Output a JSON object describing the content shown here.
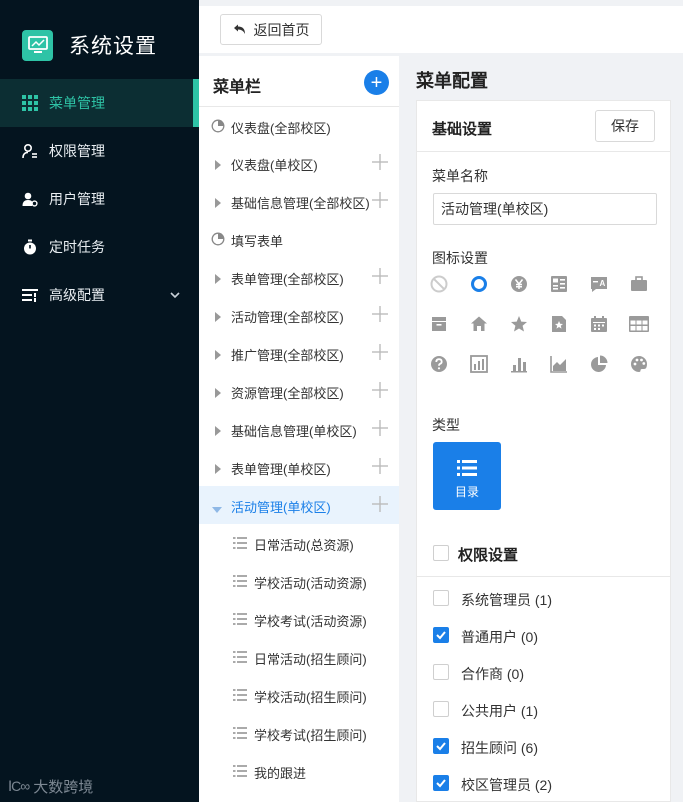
{
  "app": {
    "title": "系统设置"
  },
  "sidebar": {
    "items": [
      {
        "label": "菜单管理",
        "icon": "grid-icon"
      },
      {
        "label": "权限管理",
        "icon": "user-key-icon"
      },
      {
        "label": "用户管理",
        "icon": "user-gear-icon"
      },
      {
        "label": "定时任务",
        "icon": "stopwatch-icon"
      },
      {
        "label": "高级配置",
        "icon": "sliders-icon"
      }
    ],
    "footer": "大数跨境"
  },
  "toolbar": {
    "back_label": "返回首页"
  },
  "menu_panel": {
    "title": "菜单栏",
    "add_symbol": "+",
    "items": [
      {
        "label": "仪表盘(全部校区)"
      },
      {
        "label": "仪表盘(单校区)"
      },
      {
        "label": "基础信息管理(全部校区)"
      },
      {
        "label": "填写表单"
      },
      {
        "label": "表单管理(全部校区)"
      },
      {
        "label": "活动管理(全部校区)"
      },
      {
        "label": "推广管理(全部校区)"
      },
      {
        "label": "资源管理(全部校区)"
      },
      {
        "label": "基础信息管理(单校区)"
      },
      {
        "label": "表单管理(单校区)"
      },
      {
        "label": "活动管理(单校区)"
      },
      {
        "label": "日常活动(总资源)"
      },
      {
        "label": "学校活动(活动资源)"
      },
      {
        "label": "学校考试(活动资源)"
      },
      {
        "label": "日常活动(招生顾问)"
      },
      {
        "label": "学校活动(招生顾问)"
      },
      {
        "label": "学校考试(招生顾问)"
      },
      {
        "label": "我的跟进"
      }
    ]
  },
  "config": {
    "title": "菜单配置",
    "card_title": "基础设置",
    "save_label": "保存",
    "name_label": "菜单名称",
    "name_value": "活动管理(单校区)",
    "icon_label": "图标设置",
    "type_label": "类型",
    "type_value": "目录",
    "perm_label": "权限设置",
    "roles": [
      {
        "label": "系统管理员 (1)",
        "checked": false
      },
      {
        "label": "普通用户 (0)",
        "checked": true
      },
      {
        "label": "合作商 (0)",
        "checked": false
      },
      {
        "label": "公共用户 (1)",
        "checked": false
      },
      {
        "label": "招生顾问 (6)",
        "checked": true
      },
      {
        "label": "校区管理员 (2)",
        "checked": true
      }
    ]
  },
  "colors": {
    "sidebar_bg": "#04141f",
    "accent": "#2ec3a6",
    "primary": "#1a7fe8"
  }
}
